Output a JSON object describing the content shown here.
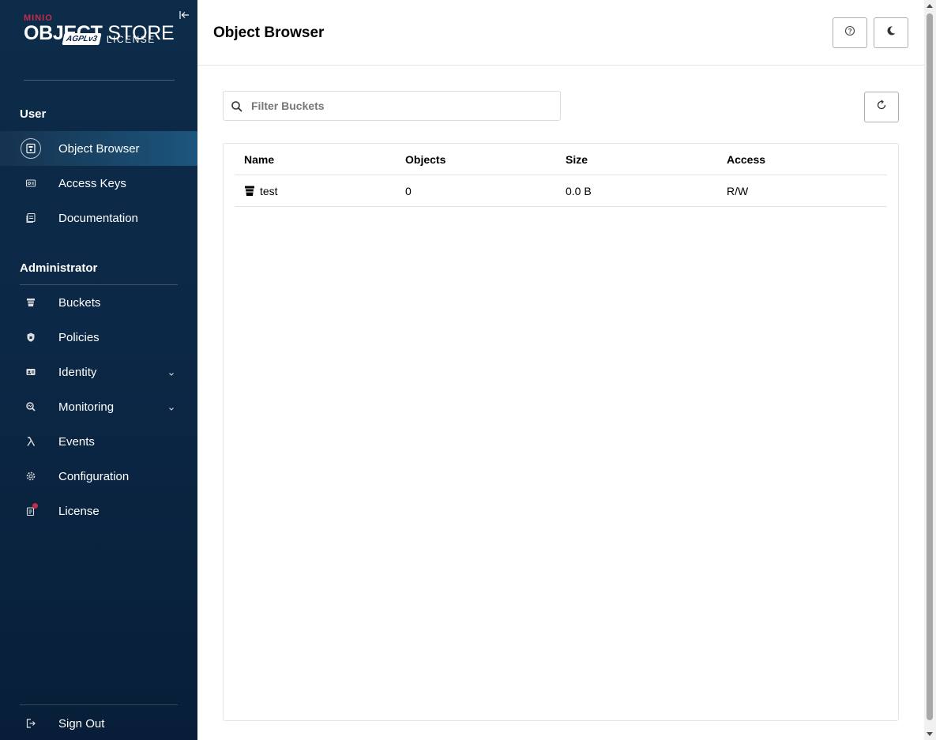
{
  "brand": {
    "minio": "MINIO",
    "object": "OBJECT",
    "store": "STORE",
    "agpl": "AGPLv3",
    "license": "LICENSE"
  },
  "sidebar": {
    "user_section": "User",
    "admin_section": "Administrator",
    "user_items": [
      {
        "label": "Object Browser",
        "icon": "object-browser-icon"
      },
      {
        "label": "Access Keys",
        "icon": "access-keys-icon"
      },
      {
        "label": "Documentation",
        "icon": "documentation-icon"
      }
    ],
    "admin_items": [
      {
        "label": "Buckets",
        "icon": "bucket-icon"
      },
      {
        "label": "Policies",
        "icon": "policies-icon"
      },
      {
        "label": "Identity",
        "icon": "identity-icon"
      },
      {
        "label": "Monitoring",
        "icon": "monitoring-icon"
      },
      {
        "label": "Events",
        "icon": "lambda-icon"
      },
      {
        "label": "Configuration",
        "icon": "gear-icon"
      },
      {
        "label": "License",
        "icon": "license-icon"
      }
    ],
    "sign_out": "Sign Out"
  },
  "header": {
    "title": "Object Browser"
  },
  "filter": {
    "placeholder": "Filter Buckets"
  },
  "table": {
    "columns": [
      "Name",
      "Objects",
      "Size",
      "Access"
    ],
    "rows": [
      {
        "name": "test",
        "objects": "0",
        "size": "0.0 B",
        "access": "R/W"
      }
    ]
  },
  "colors": {
    "sidebar_bg": "#0b2846",
    "accent_red": "#c72c48"
  }
}
